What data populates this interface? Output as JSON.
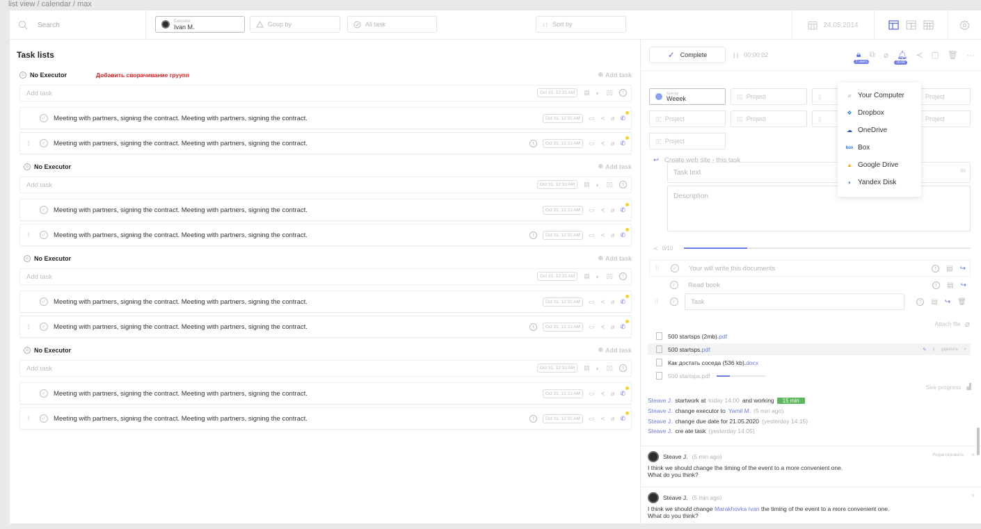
{
  "breadcrumb": "list view / calendar / max",
  "topbar": {
    "search_placeholder": "Search",
    "executor_label": "Executor",
    "executor_value": "Ivan M.",
    "group_by": "Goup by",
    "all_task": "All task",
    "sort_by": "Sort by",
    "date": "24.05.2014"
  },
  "left": {
    "title": "Task lists",
    "note": "Добавить сворачивание груупп",
    "groups": [
      {
        "name": "No Executor",
        "add_link": "Add task",
        "add_placeholder": "Add task",
        "add_date": "Oct 31, 12:31 AM",
        "tasks": [
          {
            "text": "Meeting with partners, signing the contract. Meeting with  partners, signing the contract.",
            "date": "Oct 31, 12:31 AM"
          },
          {
            "text": "Meeting with partners, signing the contract. Meeting with  partners, signing the contract.",
            "date": "Oct 31, 12:31 AM"
          }
        ]
      },
      {
        "name": "No Executor",
        "add_link": "Add task",
        "add_placeholder": "Add task",
        "add_date": "Oct 31, 12:31 AM",
        "tasks": [
          {
            "text": "Meeting with partners, signing the contract. Meeting with  partners, signing the contract.",
            "date": "Oct 31, 12:31 AM"
          },
          {
            "text": "Meeting with partners, signing the contract. Meeting with  partners, signing the contract.",
            "date": "Oct 31, 12:31 AM"
          }
        ]
      },
      {
        "name": "No Executor",
        "add_link": "Add task",
        "add_placeholder": "Add task",
        "add_date": "Oct 31, 12:31 AM",
        "tasks": [
          {
            "text": "Meeting with partners, signing the contract. Meeting with  partners, signing the contract.",
            "date": "Oct 31, 12:31 AM"
          },
          {
            "text": "Meeting with partners, signing the contract. Meeting with  partners, signing the contract.",
            "date": "Oct 31, 12:31 AM"
          }
        ]
      },
      {
        "name": "No Executor",
        "add_link": "Add task",
        "add_placeholder": "Add task",
        "add_date": "Oct 31, 12:31 AM",
        "tasks": [
          {
            "text": "Meeting with partners, signing the contract. Meeting with  partners, signing the contract.",
            "date": "Oct 31, 12:31 AM"
          },
          {
            "text": "Meeting with partners, signing the contract. Meeting with  partners, signing the contract.",
            "date": "Oct 31, 12:31 AM"
          }
        ]
      }
    ]
  },
  "right": {
    "complete": "Complete",
    "timer": "00:00:02",
    "lock_badge": "2 users",
    "alarm_badge": "16:00",
    "sort_label": "Sort by",
    "sort_value": "Weeek",
    "project": "Project",
    "parent_task": "Create web site - this task",
    "task_text_placeholder": "Task text",
    "task_text_count": "88",
    "description_placeholder": "Description",
    "subtask_progress": "0/10",
    "subtask_progress_fraction": 0.22,
    "subtasks": [
      "Your will write this documents",
      "Read book",
      "Task"
    ],
    "attach_file": "Attach file",
    "files": [
      {
        "name": "500 startsps (2mb).",
        "ext": "pdf"
      },
      {
        "name": "500 startsps.",
        "ext": "pdf",
        "delete": "удалить"
      },
      {
        "name": "Как достать соседа (536 kb).",
        "ext": "docx"
      },
      {
        "name": "500 startsps.pdf",
        "upload_fraction": 0.26
      }
    ],
    "see_progress": "See progress",
    "activity": [
      {
        "who": "Steave J.",
        "text": "startwork at",
        "time": "today 14:00",
        "text2": "and working",
        "tag": "15 min"
      },
      {
        "who": "Steave J.",
        "text": "change executor to",
        "link": "Yamil M.",
        "time": "(5 min ago)"
      },
      {
        "who": "Steave J.",
        "text": "change due date for 21.05.2020",
        "time": "(yesterday 14:15)"
      },
      {
        "who": "Steave J.",
        "text": "cre ate task",
        "time": "(yesterday 14:05)"
      }
    ],
    "comments": [
      {
        "author": "Steave J.",
        "time": "(5 min ago)",
        "edit": "Редактировать",
        "line1": "I think we should change the timing of the event to a more convenient one.",
        "line2": "What do you think?"
      },
      {
        "author": "Steave J.",
        "time": "(5 min ago)",
        "pre": "I think we should change",
        "link": "Marakhovka Ivan",
        "post": "the timing of the event to a more convenient one.",
        "line2": "What do you think?"
      }
    ]
  },
  "dropdown": {
    "items": [
      {
        "label": "Your Computer",
        "icon": "paperclip-icon"
      },
      {
        "label": "Dropbox",
        "icon": "dropbox-icon"
      },
      {
        "label": "OneDrive",
        "icon": "onedrive-icon"
      },
      {
        "label": "Box",
        "icon": "box-icon"
      },
      {
        "label": "Google Drive",
        "icon": "google-drive-icon"
      },
      {
        "label": "Yandex Disk",
        "icon": "yandex-disk-icon"
      }
    ]
  },
  "colors": {
    "accent": "#5b6de0",
    "note_red": "#e32020",
    "status_dot": "#f7d32b",
    "tag_green": "#5cb85c"
  }
}
